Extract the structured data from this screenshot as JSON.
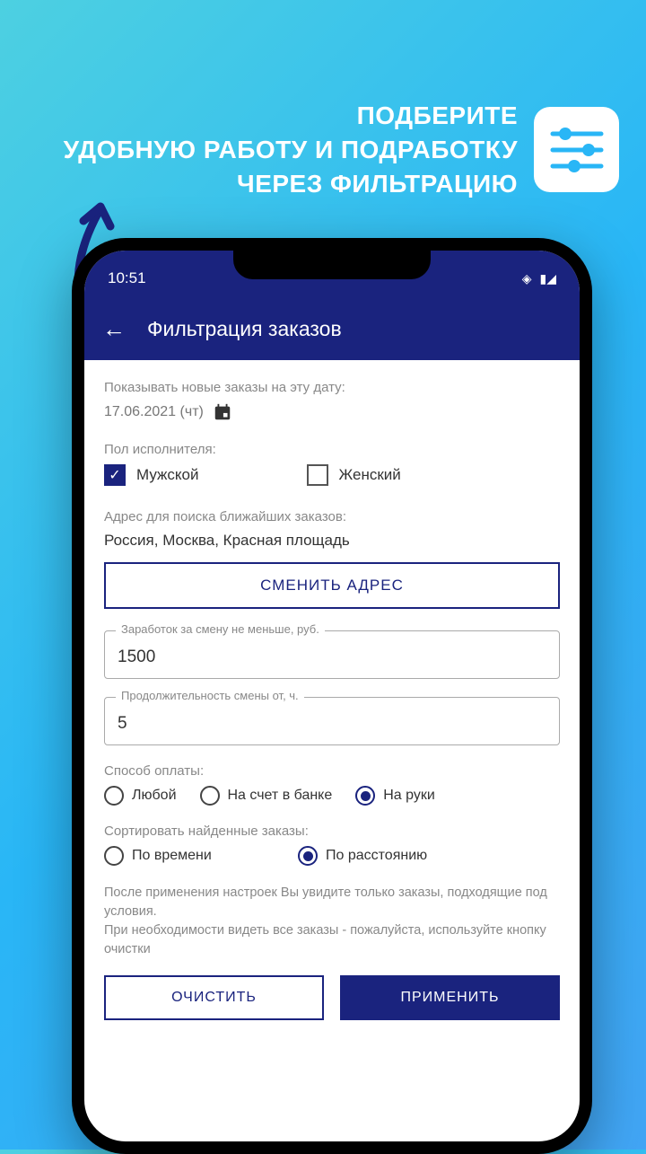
{
  "promo": {
    "line1": "ПОДБЕРИТЕ",
    "line2": "УДОБНУЮ РАБОТУ И ПОДРАБОТКУ",
    "line3": "ЧЕРЕЗ ФИЛЬТРАЦИЮ"
  },
  "status": {
    "time": "10:51"
  },
  "appbar": {
    "title": "Фильтрация заказов"
  },
  "date": {
    "label": "Показывать новые заказы на эту дату:",
    "value": "17.06.2021 (чт)"
  },
  "gender": {
    "label": "Пол исполнителя:",
    "male": "Мужской",
    "female": "Женский"
  },
  "address": {
    "label": "Адрес для поиска ближайших заказов:",
    "value": "Россия, Москва, Красная площадь",
    "change_btn": "СМЕНИТЬ АДРЕС"
  },
  "earnings": {
    "label": "Заработок за смену не меньше, руб.",
    "value": "1500"
  },
  "duration": {
    "label": "Продолжительность смены от, ч.",
    "value": "5"
  },
  "payment": {
    "label": "Способ оплаты:",
    "options": [
      "Любой",
      "На счет в банке",
      "На руки"
    ]
  },
  "sort": {
    "label": "Сортировать найденные заказы:",
    "options": [
      "По времени",
      "По расстоянию"
    ]
  },
  "info": "После применения настроек Вы увидите только заказы, подходящие под условия.\nПри необходимости видеть все заказы - пожалуйста, используйте кнопку очистки",
  "buttons": {
    "clear": "ОЧИСТИТЬ",
    "apply": "ПРИМЕНИТЬ"
  }
}
